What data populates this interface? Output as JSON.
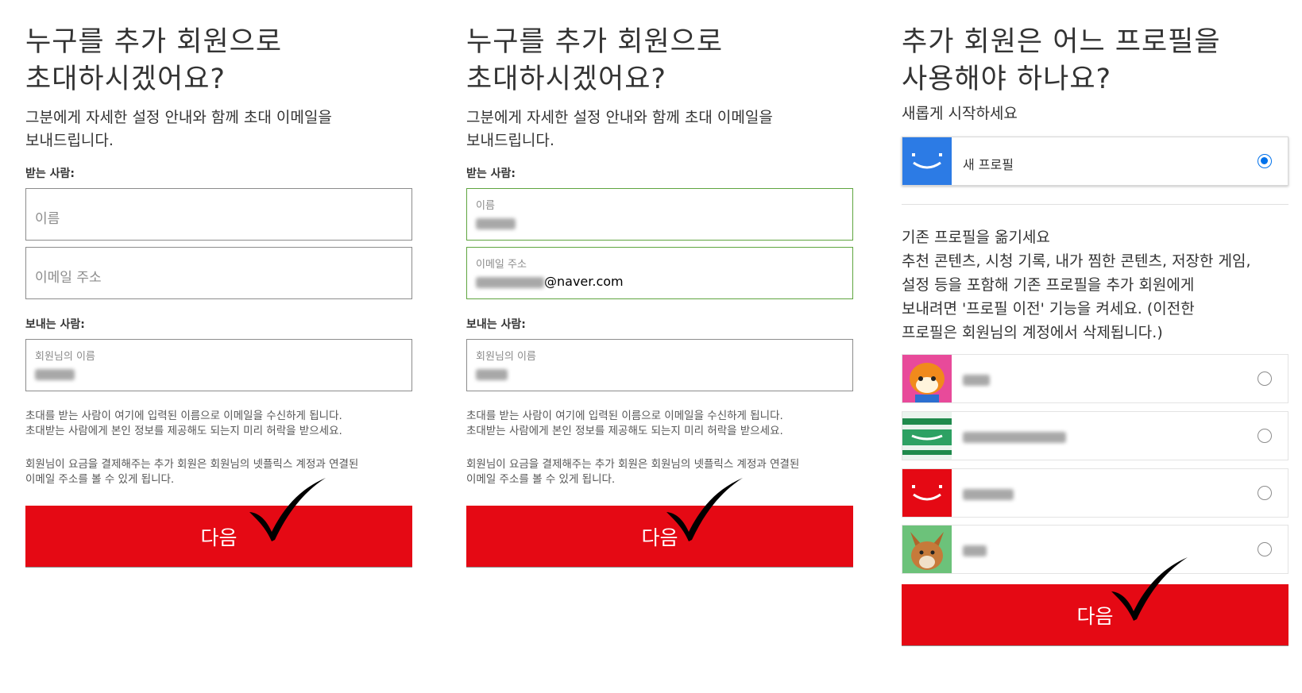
{
  "invite_panels": [
    {
      "title_line1": "누구를 추가 회원으로",
      "title_line2": "초대하시겠어요?",
      "subtitle_line1": "그분에게 자세한 설정 안내와 함께 초대 이메일을",
      "subtitle_line2": "보내드립니다.",
      "to_label": "받는 사람:",
      "name_placeholder": "이름",
      "email_placeholder": "이메일 주소",
      "from_label": "보내는 사람:",
      "sender_label": "회원님의 이름",
      "help1_line1": "초대를 받는 사람이 여기에 입력된 이름으로 이메일을 수신하게 됩니다.",
      "help1_line2": "초대받는 사람에게 본인 정보를 제공해도 되는지 미리 허락을 받으세요.",
      "help2_line1": "회원님이 요금을 결제해주는 추가 회원은 회원님의 넷플릭스 계정과 연결된",
      "help2_line2": "이메일 주소를 볼 수 있게 됩니다.",
      "next_label": "다음"
    },
    {
      "title_line1": "누구를 추가 회원으로",
      "title_line2": "초대하시겠어요?",
      "subtitle_line1": "그분에게 자세한 설정 안내와 함께 초대 이메일을",
      "subtitle_line2": "보내드립니다.",
      "to_label": "받는 사람:",
      "name_label": "이름",
      "email_label": "이메일 주소",
      "email_domain": "@naver.com",
      "from_label": "보내는 사람:",
      "sender_label": "회원님의 이름",
      "help1_line1": "초대를 받는 사람이 여기에 입력된 이름으로 이메일을 수신하게 됩니다.",
      "help1_line2": "초대받는 사람에게 본인 정보를 제공해도 되는지 미리 허락을 받으세요.",
      "help2_line1": "회원님이 요금을 결제해주는 추가 회원은 회원님의 넷플릭스 계정과 연결된",
      "help2_line2": "이메일 주소를 볼 수 있게 됩니다.",
      "next_label": "다음"
    }
  ],
  "profile_panel": {
    "title_line1": "추가 회원은 어느 프로필을",
    "title_line2": "사용해야 하나요?",
    "start_fresh_label": "새롭게 시작하세요",
    "new_profile_label": "새 프로필",
    "transfer_title": "기존 프로필을 옮기세요",
    "transfer_line1": "추천 콘텐츠, 시청 기록, 내가 찜한 콘텐츠, 저장한 게임,",
    "transfer_line2": "설정 등을 포함해 기존 프로필을 추가 회원에게",
    "transfer_line3": "보내려면 '프로필 이전' 기능을 켜세요. (이전한",
    "transfer_line4": "프로필은 회원님의 계정에서 삭제됩니다.)",
    "next_label": "다음",
    "existing_profiles": [
      {
        "avatar": "red-panda-avatar"
      },
      {
        "avatar": "green-smile-avatar"
      },
      {
        "avatar": "red-smile-avatar"
      },
      {
        "avatar": "fox-avatar"
      }
    ]
  },
  "colors": {
    "netflix_red": "#e50914",
    "valid_green": "#5fa53f",
    "radio_blue": "#0071eb",
    "new_profile_blue": "#2c7be5"
  }
}
